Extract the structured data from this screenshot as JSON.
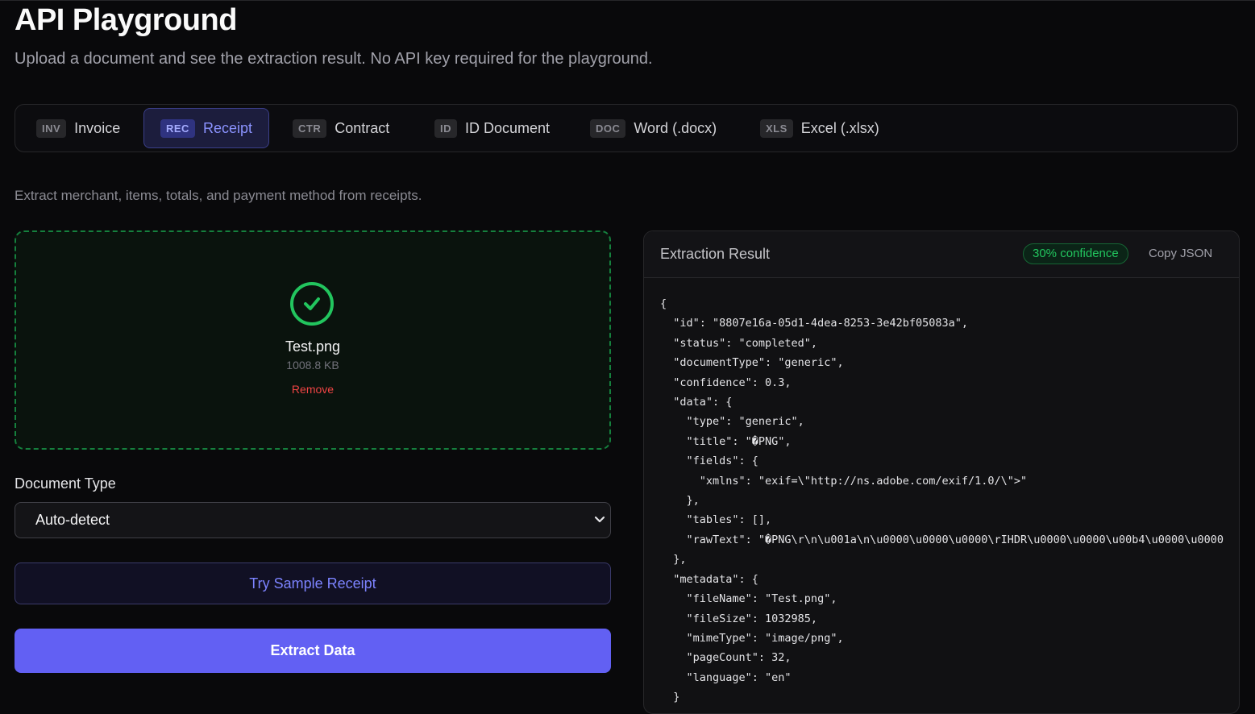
{
  "page": {
    "title": "API Playground",
    "subtitle": "Upload a document and see the extraction result. No API key required for the playground."
  },
  "tabs": [
    {
      "abbr": "INV",
      "label": "Invoice",
      "active": false
    },
    {
      "abbr": "REC",
      "label": "Receipt",
      "active": true
    },
    {
      "abbr": "CTR",
      "label": "Contract",
      "active": false
    },
    {
      "abbr": "ID",
      "label": "ID Document",
      "active": false
    },
    {
      "abbr": "DOC",
      "label": "Word (.docx)",
      "active": false
    },
    {
      "abbr": "XLS",
      "label": "Excel (.xlsx)",
      "active": false
    }
  ],
  "description": "Extract merchant, items, totals, and payment method from receipts.",
  "upload": {
    "status_icon": "check-circle-icon",
    "file_name": "Test.png",
    "file_size": "1008.8 KB",
    "remove_label": "Remove"
  },
  "document_type": {
    "label": "Document Type",
    "selected": "Auto-detect"
  },
  "buttons": {
    "sample": "Try Sample Receipt",
    "extract": "Extract Data"
  },
  "result": {
    "title": "Extraction Result",
    "confidence_badge": "30% confidence",
    "copy_label": "Copy JSON",
    "json_lines": [
      "{",
      "  \"id\": \"8807e16a-05d1-4dea-8253-3e42bf05083a\",",
      "  \"status\": \"completed\",",
      "  \"documentType\": \"generic\",",
      "  \"confidence\": 0.3,",
      "  \"data\": {",
      "    \"type\": \"generic\",",
      "    \"title\": \"�PNG\",",
      "    \"fields\": {",
      "      \"xmlns\": \"exif=\\\"http://ns.adobe.com/exif/1.0/\\\">\"",
      "    },",
      "    \"tables\": [],",
      "    \"rawText\": \"�PNG\\r\\n\\u001a\\n\\u0000\\u0000\\u0000\\rIHDR\\u0000\\u0000\\u00b4\\u0000\\u0000",
      "  },",
      "  \"metadata\": {",
      "    \"fileName\": \"Test.png\",",
      "    \"fileSize\": 1032985,",
      "    \"mimeType\": \"image/png\",",
      "    \"pageCount\": 32,",
      "    \"language\": \"en\"",
      "  }"
    ]
  },
  "colors": {
    "background": "#09090b",
    "accent": "#6260f3",
    "success": "#22c55e",
    "danger": "#ef4444"
  }
}
